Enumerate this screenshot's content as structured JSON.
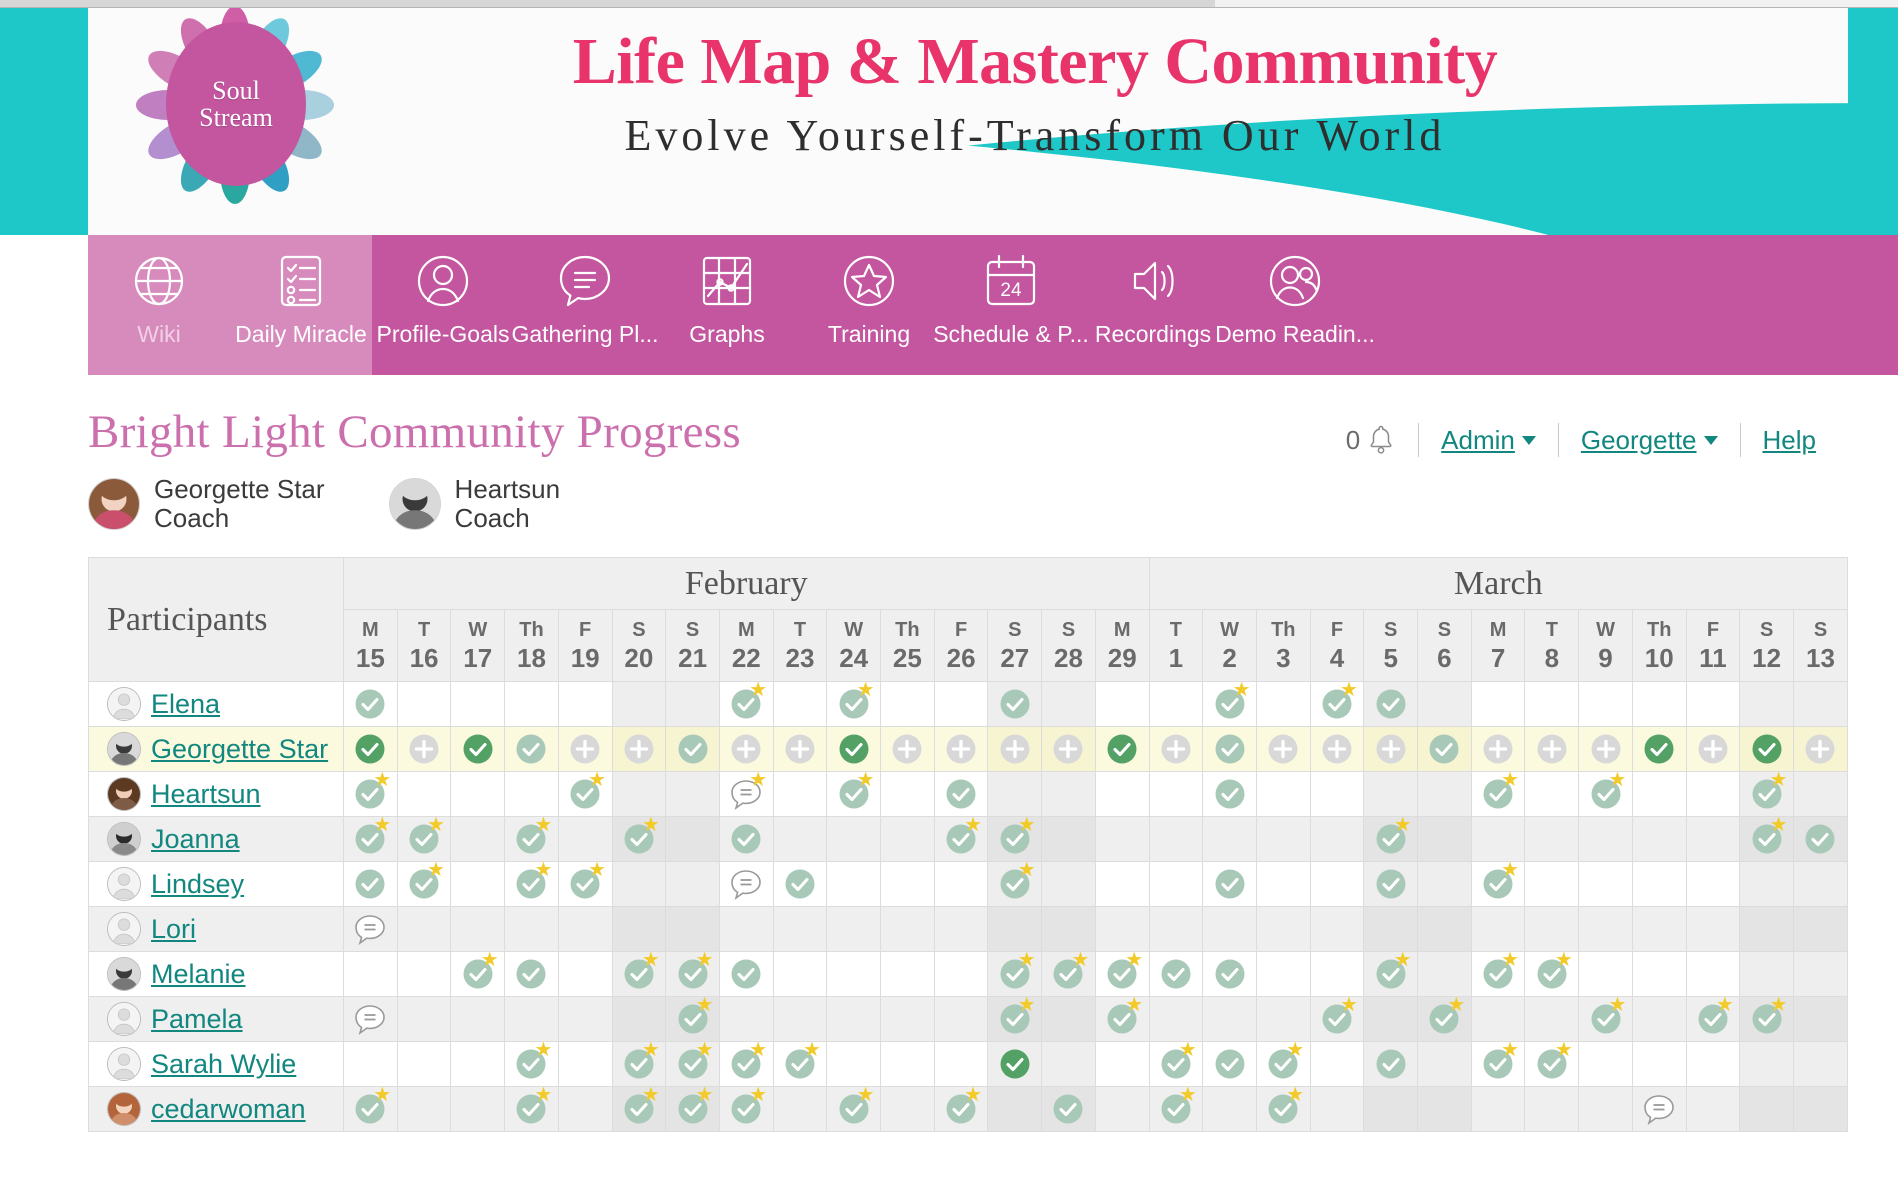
{
  "banner": {
    "logo_line1": "Soul",
    "logo_line2": "Stream",
    "title": "Life Map & Mastery Community",
    "subtitle": "Evolve Yourself-Transform Our World",
    "teal": "#1ec8c8",
    "pink": "#e8336b",
    "magenta": "#c3569f"
  },
  "nav": {
    "items": [
      {
        "label": "Wiki",
        "icon": "globe-icon",
        "highlighted": true,
        "dim": true
      },
      {
        "label": "Daily Miracle",
        "icon": "checklist-icon",
        "highlighted": true,
        "dim": false
      },
      {
        "label": "Profile-Goals",
        "icon": "user-circle-icon",
        "highlighted": false,
        "dim": false
      },
      {
        "label": "Gathering Pl...",
        "icon": "chat-circle-icon",
        "highlighted": false,
        "dim": false
      },
      {
        "label": "Graphs",
        "icon": "graph-grid-icon",
        "highlighted": false,
        "dim": false
      },
      {
        "label": "Training",
        "icon": "star-circle-icon",
        "highlighted": false,
        "dim": false
      },
      {
        "label": "Schedule & P...",
        "icon": "calendar-24-icon",
        "highlighted": false,
        "dim": false
      },
      {
        "label": "Recordings",
        "icon": "speaker-icon",
        "highlighted": false,
        "dim": false
      },
      {
        "label": "Demo Readin...",
        "icon": "two-users-icon",
        "highlighted": false,
        "dim": false
      }
    ]
  },
  "header": {
    "page_title": "Bright Light Community Progress",
    "notification_count": "0",
    "admin_label": "Admin",
    "user_label": "Georgette",
    "help_label": "Help",
    "link_color": "#12877f"
  },
  "coaches": [
    {
      "name": "Georgette Star",
      "role": "Coach",
      "avatar": "photo"
    },
    {
      "name": "Heartsun",
      "role": "Coach",
      "avatar": "photo"
    }
  ],
  "table": {
    "participants_header": "Participants",
    "months": [
      {
        "name": "February",
        "span": 15
      },
      {
        "name": "March",
        "span": 13
      }
    ],
    "days": [
      {
        "dow": "M",
        "num": "15",
        "weekend": false
      },
      {
        "dow": "T",
        "num": "16",
        "weekend": false
      },
      {
        "dow": "W",
        "num": "17",
        "weekend": false
      },
      {
        "dow": "Th",
        "num": "18",
        "weekend": false
      },
      {
        "dow": "F",
        "num": "19",
        "weekend": false
      },
      {
        "dow": "S",
        "num": "20",
        "weekend": true
      },
      {
        "dow": "S",
        "num": "21",
        "weekend": true
      },
      {
        "dow": "M",
        "num": "22",
        "weekend": false
      },
      {
        "dow": "T",
        "num": "23",
        "weekend": false
      },
      {
        "dow": "W",
        "num": "24",
        "weekend": false
      },
      {
        "dow": "Th",
        "num": "25",
        "weekend": false
      },
      {
        "dow": "F",
        "num": "26",
        "weekend": false
      },
      {
        "dow": "S",
        "num": "27",
        "weekend": true
      },
      {
        "dow": "S",
        "num": "28",
        "weekend": true
      },
      {
        "dow": "M",
        "num": "29",
        "weekend": false
      },
      {
        "dow": "T",
        "num": "1",
        "weekend": false
      },
      {
        "dow": "W",
        "num": "2",
        "weekend": false
      },
      {
        "dow": "Th",
        "num": "3",
        "weekend": false
      },
      {
        "dow": "F",
        "num": "4",
        "weekend": false
      },
      {
        "dow": "S",
        "num": "5",
        "weekend": true
      },
      {
        "dow": "S",
        "num": "6",
        "weekend": true
      },
      {
        "dow": "M",
        "num": "7",
        "weekend": false
      },
      {
        "dow": "T",
        "num": "8",
        "weekend": false
      },
      {
        "dow": "W",
        "num": "9",
        "weekend": false
      },
      {
        "dow": "Th",
        "num": "10",
        "weekend": false
      },
      {
        "dow": "F",
        "num": "11",
        "weekend": false
      },
      {
        "dow": "S",
        "num": "12",
        "weekend": true
      },
      {
        "dow": "S",
        "num": "13",
        "weekend": true
      }
    ],
    "legend": {
      "check": "completed-check",
      "check_dark": "completed-check-highlight",
      "plus": "add-entry-plus",
      "comment": "comment-bubble",
      "star": "star-badge",
      "empty": "empty-cell"
    },
    "rows": [
      {
        "name": "Elena",
        "avatar": "silhouette",
        "highlight": "none",
        "banded": false,
        "cells": [
          "check",
          "",
          "",
          "",
          "",
          "",
          "",
          "check+star",
          "",
          "check+star",
          "",
          "",
          "check",
          "",
          "",
          "",
          "check+star",
          "",
          "check+star",
          "check"
        ]
      },
      {
        "name": "Georgette Star",
        "avatar": "photo",
        "highlight": "self",
        "banded": false,
        "cells": [
          "check-dark",
          "plus",
          "check-dark",
          "check",
          "plus",
          "plus",
          "check",
          "plus",
          "plus",
          "check-dark",
          "plus",
          "plus",
          "plus",
          "plus",
          "check-dark",
          "plus",
          "check",
          "plus",
          "plus",
          "plus",
          "check",
          "plus",
          "plus",
          "plus",
          "check-dark",
          "plus",
          "check-dark",
          "plus"
        ]
      },
      {
        "name": "Heartsun",
        "avatar": "photo",
        "highlight": "none",
        "banded": false,
        "cells": [
          "check+star",
          "",
          "",
          "",
          "check+star",
          "",
          "",
          "comment+star",
          "",
          "check+star",
          "",
          "check",
          "",
          "",
          "",
          "",
          "check",
          "",
          "",
          "",
          "",
          "check+star",
          "",
          "check+star",
          "",
          "",
          "check+star",
          ""
        ]
      },
      {
        "name": "Joanna",
        "avatar": "photo",
        "highlight": "none",
        "banded": true,
        "cells": [
          "check+star",
          "check+star",
          "",
          "check+star",
          "",
          "check+star",
          "",
          "check",
          "",
          "",
          "",
          "check+star",
          "check+star",
          "",
          "",
          "",
          "",
          "",
          "",
          "check+star",
          "",
          "",
          "",
          "",
          "",
          "",
          "check+star",
          "check"
        ]
      },
      {
        "name": "Lindsey",
        "avatar": "silhouette",
        "highlight": "none",
        "banded": false,
        "cells": [
          "check",
          "check+star",
          "",
          "check+star",
          "check+star",
          "",
          "",
          "comment",
          "check",
          "",
          "",
          "",
          "check+star",
          "",
          "",
          "",
          "check",
          "",
          "",
          "check",
          "",
          "check+star",
          "",
          "",
          "",
          "",
          "",
          ""
        ]
      },
      {
        "name": "Lori",
        "avatar": "silhouette",
        "highlight": "none",
        "banded": true,
        "cells": [
          "comment",
          "",
          "",
          "",
          "",
          "",
          "",
          "",
          "",
          "",
          "",
          "",
          "",
          "",
          "",
          "",
          "",
          "",
          "",
          "",
          "",
          "",
          "",
          "",
          "",
          "",
          "",
          ""
        ]
      },
      {
        "name": "Melanie",
        "avatar": "photo",
        "highlight": "none",
        "banded": false,
        "cells": [
          "",
          "",
          "check+star",
          "check",
          "",
          "check+star",
          "check+star",
          "check",
          "",
          "",
          "",
          "",
          "check+star",
          "check+star",
          "check+star",
          "check",
          "check",
          "",
          "",
          "check+star",
          "",
          "check+star",
          "check+star",
          "",
          "",
          "",
          "",
          ""
        ]
      },
      {
        "name": "Pamela",
        "avatar": "silhouette",
        "highlight": "none",
        "banded": true,
        "cells": [
          "comment",
          "",
          "",
          "",
          "",
          "",
          "check+star",
          "",
          "",
          "",
          "",
          "",
          "check+star",
          "",
          "check+star",
          "",
          "",
          "",
          "check+star",
          "",
          "check+star",
          "",
          "",
          "check+star",
          "",
          "check+star",
          "check+star",
          ""
        ]
      },
      {
        "name": "Sarah Wylie",
        "avatar": "silhouette",
        "highlight": "none",
        "banded": false,
        "cells": [
          "",
          "",
          "",
          "check+star",
          "",
          "check+star",
          "check+star",
          "check+star",
          "check+star",
          "",
          "",
          "",
          "check-dark",
          "",
          "",
          "check+star",
          "check",
          "check+star",
          "",
          "check",
          "",
          "check+star",
          "check+star",
          "",
          "",
          "",
          "",
          ""
        ]
      },
      {
        "name": "cedarwoman",
        "avatar": "photo",
        "highlight": "none",
        "banded": true,
        "cells": [
          "check+star",
          "",
          "",
          "check+star",
          "",
          "check+star",
          "check+star",
          "check+star",
          "",
          "check+star",
          "",
          "check+star",
          "",
          "check",
          "",
          "check+star",
          "",
          "check+star",
          "",
          "",
          "",
          "",
          "",
          "",
          "comment",
          "",
          "",
          ""
        ]
      }
    ]
  }
}
